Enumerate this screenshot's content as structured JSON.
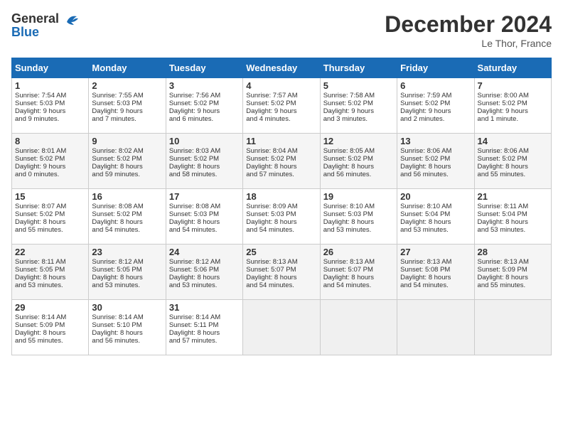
{
  "header": {
    "logo_general": "General",
    "logo_blue": "Blue",
    "title": "December 2024",
    "location": "Le Thor, France"
  },
  "columns": [
    "Sunday",
    "Monday",
    "Tuesday",
    "Wednesday",
    "Thursday",
    "Friday",
    "Saturday"
  ],
  "weeks": [
    [
      {
        "day": "1",
        "info": "Sunrise: 7:54 AM\nSunset: 5:03 PM\nDaylight: 9 hours\nand 9 minutes."
      },
      {
        "day": "2",
        "info": "Sunrise: 7:55 AM\nSunset: 5:03 PM\nDaylight: 9 hours\nand 7 minutes."
      },
      {
        "day": "3",
        "info": "Sunrise: 7:56 AM\nSunset: 5:02 PM\nDaylight: 9 hours\nand 6 minutes."
      },
      {
        "day": "4",
        "info": "Sunrise: 7:57 AM\nSunset: 5:02 PM\nDaylight: 9 hours\nand 4 minutes."
      },
      {
        "day": "5",
        "info": "Sunrise: 7:58 AM\nSunset: 5:02 PM\nDaylight: 9 hours\nand 3 minutes."
      },
      {
        "day": "6",
        "info": "Sunrise: 7:59 AM\nSunset: 5:02 PM\nDaylight: 9 hours\nand 2 minutes."
      },
      {
        "day": "7",
        "info": "Sunrise: 8:00 AM\nSunset: 5:02 PM\nDaylight: 9 hours\nand 1 minute."
      }
    ],
    [
      {
        "day": "8",
        "info": "Sunrise: 8:01 AM\nSunset: 5:02 PM\nDaylight: 9 hours\nand 0 minutes."
      },
      {
        "day": "9",
        "info": "Sunrise: 8:02 AM\nSunset: 5:02 PM\nDaylight: 8 hours\nand 59 minutes."
      },
      {
        "day": "10",
        "info": "Sunrise: 8:03 AM\nSunset: 5:02 PM\nDaylight: 8 hours\nand 58 minutes."
      },
      {
        "day": "11",
        "info": "Sunrise: 8:04 AM\nSunset: 5:02 PM\nDaylight: 8 hours\nand 57 minutes."
      },
      {
        "day": "12",
        "info": "Sunrise: 8:05 AM\nSunset: 5:02 PM\nDaylight: 8 hours\nand 56 minutes."
      },
      {
        "day": "13",
        "info": "Sunrise: 8:06 AM\nSunset: 5:02 PM\nDaylight: 8 hours\nand 56 minutes."
      },
      {
        "day": "14",
        "info": "Sunrise: 8:06 AM\nSunset: 5:02 PM\nDaylight: 8 hours\nand 55 minutes."
      }
    ],
    [
      {
        "day": "15",
        "info": "Sunrise: 8:07 AM\nSunset: 5:02 PM\nDaylight: 8 hours\nand 55 minutes."
      },
      {
        "day": "16",
        "info": "Sunrise: 8:08 AM\nSunset: 5:02 PM\nDaylight: 8 hours\nand 54 minutes."
      },
      {
        "day": "17",
        "info": "Sunrise: 8:08 AM\nSunset: 5:03 PM\nDaylight: 8 hours\nand 54 minutes."
      },
      {
        "day": "18",
        "info": "Sunrise: 8:09 AM\nSunset: 5:03 PM\nDaylight: 8 hours\nand 54 minutes."
      },
      {
        "day": "19",
        "info": "Sunrise: 8:10 AM\nSunset: 5:03 PM\nDaylight: 8 hours\nand 53 minutes."
      },
      {
        "day": "20",
        "info": "Sunrise: 8:10 AM\nSunset: 5:04 PM\nDaylight: 8 hours\nand 53 minutes."
      },
      {
        "day": "21",
        "info": "Sunrise: 8:11 AM\nSunset: 5:04 PM\nDaylight: 8 hours\nand 53 minutes."
      }
    ],
    [
      {
        "day": "22",
        "info": "Sunrise: 8:11 AM\nSunset: 5:05 PM\nDaylight: 8 hours\nand 53 minutes."
      },
      {
        "day": "23",
        "info": "Sunrise: 8:12 AM\nSunset: 5:05 PM\nDaylight: 8 hours\nand 53 minutes."
      },
      {
        "day": "24",
        "info": "Sunrise: 8:12 AM\nSunset: 5:06 PM\nDaylight: 8 hours\nand 53 minutes."
      },
      {
        "day": "25",
        "info": "Sunrise: 8:13 AM\nSunset: 5:07 PM\nDaylight: 8 hours\nand 54 minutes."
      },
      {
        "day": "26",
        "info": "Sunrise: 8:13 AM\nSunset: 5:07 PM\nDaylight: 8 hours\nand 54 minutes."
      },
      {
        "day": "27",
        "info": "Sunrise: 8:13 AM\nSunset: 5:08 PM\nDaylight: 8 hours\nand 54 minutes."
      },
      {
        "day": "28",
        "info": "Sunrise: 8:13 AM\nSunset: 5:09 PM\nDaylight: 8 hours\nand 55 minutes."
      }
    ],
    [
      {
        "day": "29",
        "info": "Sunrise: 8:14 AM\nSunset: 5:09 PM\nDaylight: 8 hours\nand 55 minutes."
      },
      {
        "day": "30",
        "info": "Sunrise: 8:14 AM\nSunset: 5:10 PM\nDaylight: 8 hours\nand 56 minutes."
      },
      {
        "day": "31",
        "info": "Sunrise: 8:14 AM\nSunset: 5:11 PM\nDaylight: 8 hours\nand 57 minutes."
      },
      null,
      null,
      null,
      null
    ]
  ]
}
